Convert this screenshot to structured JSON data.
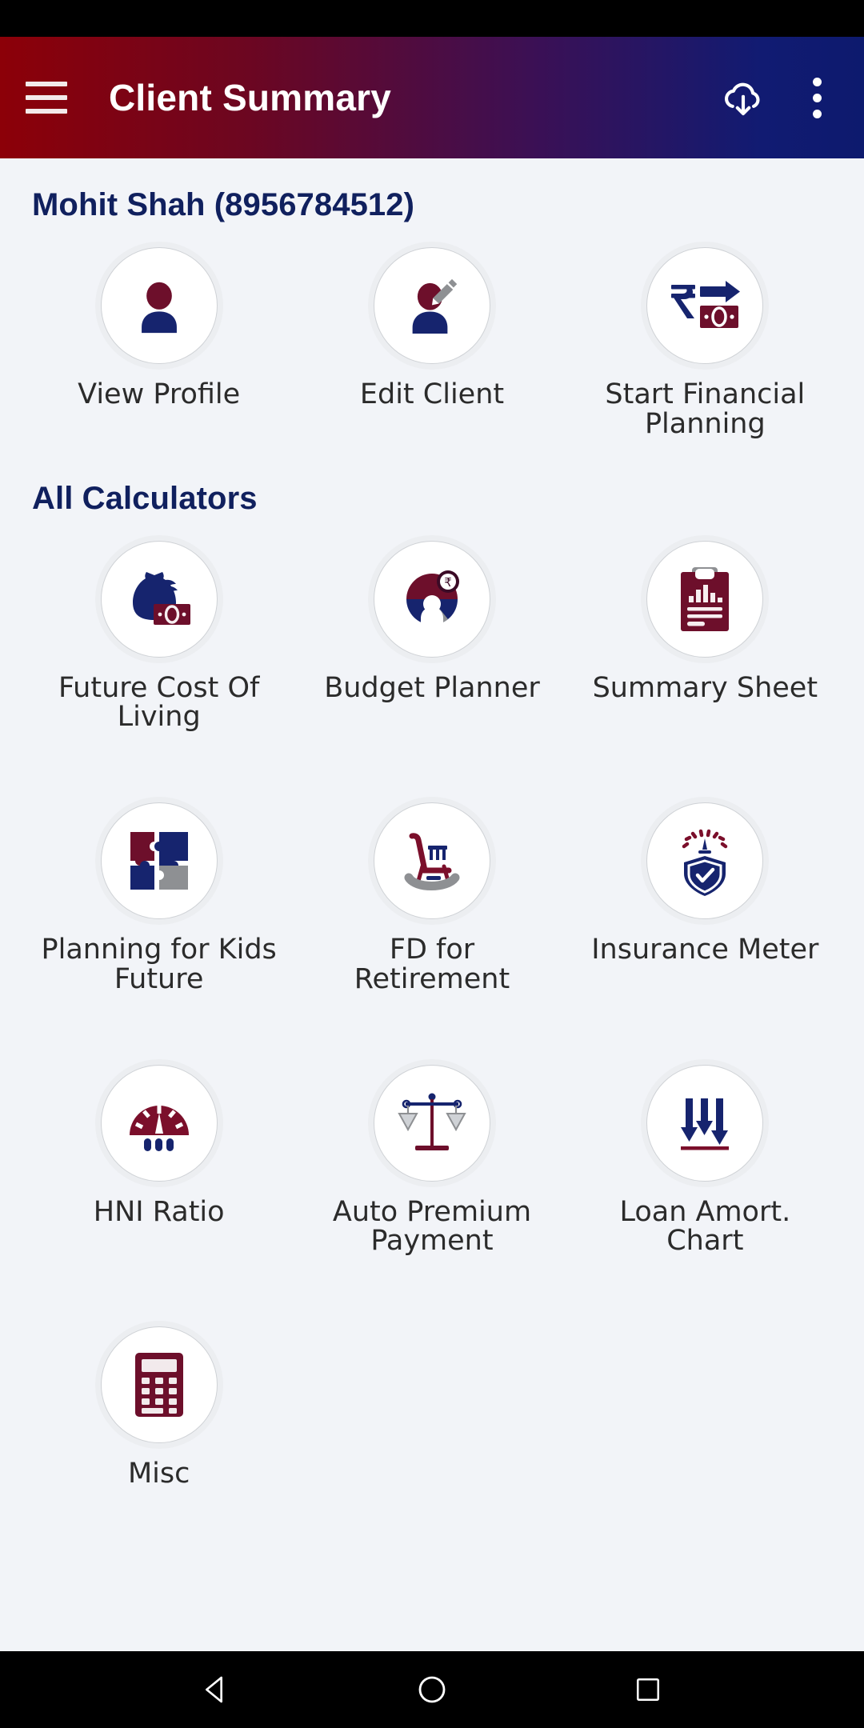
{
  "app_bar": {
    "title": "Client Summary",
    "menu_icon": "hamburger-menu-icon",
    "download_icon": "cloud-download-icon",
    "overflow_icon": "more-vertical-icon"
  },
  "client": {
    "name_line": "Mohit Shah (8956784512)"
  },
  "actions": {
    "items": [
      {
        "label": "View Profile",
        "icon": "person-icon"
      },
      {
        "label": "Edit Client",
        "icon": "person-edit-pencil-icon"
      },
      {
        "label": "Start Financial Planning",
        "icon": "rupee-transfer-banknote-icon"
      }
    ]
  },
  "calculators": {
    "heading": "All Calculators",
    "items": [
      {
        "label": "Future Cost Of Living",
        "icon": "money-bag-banknote-icon"
      },
      {
        "label": "Budget Planner",
        "icon": "donut-chart-rupee-icon"
      },
      {
        "label": "Summary Sheet",
        "icon": "clipboard-chart-icon"
      },
      {
        "label": "Planning for Kids Future",
        "icon": "puzzle-pieces-icon"
      },
      {
        "label": "FD for Retirement",
        "icon": "rocking-chair-icon"
      },
      {
        "label": "Insurance Meter",
        "icon": "gauge-shield-check-icon"
      },
      {
        "label": "HNI Ratio",
        "icon": "speedometer-dial-icon"
      },
      {
        "label": "Auto Premium Payment",
        "icon": "balance-scales-icon"
      },
      {
        "label": "Loan Amort. Chart",
        "icon": "down-arrows-icon"
      },
      {
        "label": "Misc",
        "icon": "calculator-icon"
      }
    ]
  },
  "system_nav": {
    "back": "back-triangle-icon",
    "home": "home-circle-icon",
    "recents": "recents-square-icon"
  },
  "colors": {
    "brand_red": "#7b0f2b",
    "brand_navy": "#16246e",
    "gray": "#8e9093",
    "header_red": "#8c0008",
    "header_blue": "#0d1a6e",
    "page_bg": "#f2f4f8",
    "heading_navy": "#10205e"
  }
}
